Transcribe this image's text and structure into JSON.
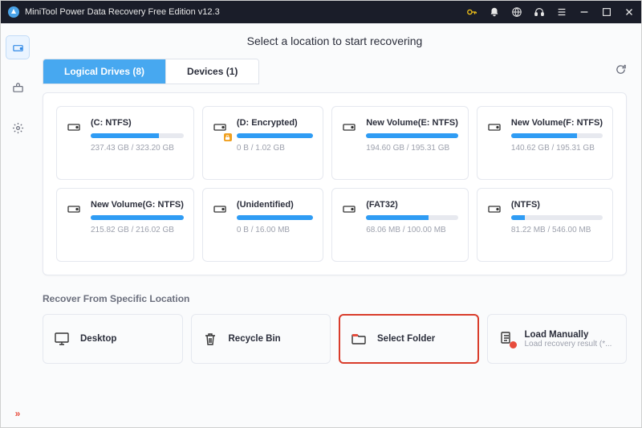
{
  "titlebar": {
    "title": "MiniTool Power Data Recovery Free Edition v12.3"
  },
  "page_title": "Select a location to start recovering",
  "tabs": {
    "logical": "Logical Drives (8)",
    "devices": "Devices (1)"
  },
  "drives": [
    {
      "name": "(C: NTFS)",
      "size": "237.43 GB / 323.20 GB",
      "fill": 73
    },
    {
      "name": "(D: Encrypted)",
      "size": "0 B / 1.02 GB",
      "fill": 100,
      "locked": true
    },
    {
      "name": "New Volume(E: NTFS)",
      "size": "194.60 GB / 195.31 GB",
      "fill": 100
    },
    {
      "name": "New Volume(F: NTFS)",
      "size": "140.62 GB / 195.31 GB",
      "fill": 72
    },
    {
      "name": "New Volume(G: NTFS)",
      "size": "215.82 GB / 216.02 GB",
      "fill": 100
    },
    {
      "name": "(Unidentified)",
      "size": "0 B / 16.00 MB",
      "fill": 100
    },
    {
      "name": "(FAT32)",
      "size": "68.06 MB / 100.00 MB",
      "fill": 68
    },
    {
      "name": "(NTFS)",
      "size": "81.22 MB / 546.00 MB",
      "fill": 15
    }
  ],
  "section_specific": "Recover From Specific Location",
  "locations": {
    "desktop": "Desktop",
    "recycle": "Recycle Bin",
    "folder": "Select Folder",
    "manual": {
      "name": "Load Manually",
      "sub": "Load recovery result (*..."
    }
  }
}
